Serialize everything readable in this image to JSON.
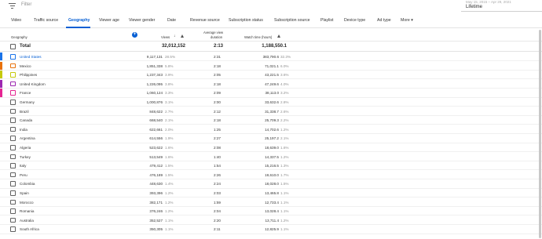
{
  "topbar": {
    "filter_placeholder": "Filter",
    "date_range": "May 15, 2015 – Apr 29, 2021",
    "date_value": "Lifetime"
  },
  "tabs": [
    {
      "label": "Video"
    },
    {
      "label": "Traffic source"
    },
    {
      "label": "Geography"
    },
    {
      "label": "Viewer age"
    },
    {
      "label": "Viewer gender"
    },
    {
      "label": "Date"
    },
    {
      "label": "Revenue source"
    },
    {
      "label": "Subscription status"
    },
    {
      "label": "Subscription source"
    },
    {
      "label": "Playlist"
    },
    {
      "label": "Device type"
    },
    {
      "label": "Ad type"
    },
    {
      "label": "More ▾"
    }
  ],
  "active_tab": "Geography",
  "columns": {
    "geography": "Geography",
    "views": "Views",
    "avd_line1": "Average view",
    "avd_line2": "duration",
    "watch_time": "Watch time (hours)"
  },
  "total": {
    "label": "Total",
    "views": "32,012,152",
    "avd": "2:13",
    "watch": "1,188,550.1"
  },
  "colors": {
    "accent": "#065fd4",
    "series": [
      "#1a73e8",
      "#e8710a",
      "#c5c90a",
      "#9c27b0",
      "#e52592"
    ]
  },
  "rows": [
    {
      "country": "United States",
      "views": "9,117,131",
      "vpct": "28.5%",
      "avd": "2:31",
      "watch": "383,790.6",
      "wpct": "32.3%",
      "color": "#1a73e8",
      "checked": true
    },
    {
      "country": "Mexico",
      "views": "1,851,338",
      "vpct": "5.8%",
      "avd": "2:18",
      "watch": "71,021.1",
      "wpct": "6.0%",
      "color": "#e8710a",
      "checked": true
    },
    {
      "country": "Philippines",
      "views": "1,237,343",
      "vpct": "3.9%",
      "avd": "2:05",
      "watch": "43,221.5",
      "wpct": "3.6%",
      "color": "#c5c90a",
      "checked": true
    },
    {
      "country": "United Kingdom",
      "views": "1,226,095",
      "vpct": "3.8%",
      "avd": "2:18",
      "watch": "47,249.6",
      "wpct": "4.0%",
      "color": "#9c27b0",
      "checked": true
    },
    {
      "country": "France",
      "views": "1,060,124",
      "vpct": "3.3%",
      "avd": "2:09",
      "watch": "38,113.0",
      "wpct": "3.2%",
      "color": "#e52592",
      "checked": true
    },
    {
      "country": "Germany",
      "views": "1,000,876",
      "vpct": "3.1%",
      "avd": "2:00",
      "watch": "33,632.6",
      "wpct": "2.8%",
      "color": "",
      "checked": false
    },
    {
      "country": "Brazil",
      "views": "848,622",
      "vpct": "2.7%",
      "avd": "2:12",
      "watch": "31,338.7",
      "wpct": "2.6%",
      "color": "",
      "checked": false
    },
    {
      "country": "Canada",
      "views": "668,540",
      "vpct": "2.1%",
      "avd": "2:18",
      "watch": "25,709.3",
      "wpct": "2.2%",
      "color": "",
      "checked": false
    },
    {
      "country": "India",
      "views": "622,661",
      "vpct": "2.0%",
      "avd": "1:25",
      "watch": "14,702.6",
      "wpct": "1.2%",
      "color": "",
      "checked": false
    },
    {
      "country": "Argentina",
      "views": "614,556",
      "vpct": "1.9%",
      "avd": "2:27",
      "watch": "25,197.2",
      "wpct": "2.1%",
      "color": "",
      "checked": false
    },
    {
      "country": "Algeria",
      "views": "523,622",
      "vpct": "1.6%",
      "avd": "2:08",
      "watch": "18,639.0",
      "wpct": "1.6%",
      "color": "",
      "checked": false
    },
    {
      "country": "Turkey",
      "views": "513,549",
      "vpct": "1.6%",
      "avd": "1:40",
      "watch": "14,337.5",
      "wpct": "1.2%",
      "color": "",
      "checked": false
    },
    {
      "country": "Italy",
      "views": "479,412",
      "vpct": "1.5%",
      "avd": "1:54",
      "watch": "15,216.5",
      "wpct": "1.3%",
      "color": "",
      "checked": false
    },
    {
      "country": "Peru",
      "views": "476,189",
      "vpct": "1.5%",
      "avd": "2:26",
      "watch": "19,610.0",
      "wpct": "1.7%",
      "color": "",
      "checked": false
    },
    {
      "country": "Colombia",
      "views": "448,630",
      "vpct": "1.4%",
      "avd": "2:24",
      "watch": "18,028.0",
      "wpct": "1.5%",
      "color": "",
      "checked": false
    },
    {
      "country": "Spain",
      "views": "393,396",
      "vpct": "1.2%",
      "avd": "2:03",
      "watch": "13,465.8",
      "wpct": "1.1%",
      "color": "",
      "checked": false
    },
    {
      "country": "Morocco",
      "views": "382,171",
      "vpct": "1.2%",
      "avd": "1:59",
      "watch": "12,733.4",
      "wpct": "1.1%",
      "color": "",
      "checked": false
    },
    {
      "country": "Romania",
      "views": "376,246",
      "vpct": "1.2%",
      "avd": "2:04",
      "watch": "13,028.4",
      "wpct": "1.1%",
      "color": "",
      "checked": false
    },
    {
      "country": "Australia",
      "views": "352,527",
      "vpct": "1.1%",
      "avd": "2:20",
      "watch": "13,711.4",
      "wpct": "1.2%",
      "color": "",
      "checked": false
    },
    {
      "country": "South Africa",
      "views": "350,305",
      "vpct": "1.1%",
      "avd": "2:11",
      "watch": "12,825.9",
      "wpct": "1.1%",
      "color": "",
      "checked": false
    }
  ]
}
